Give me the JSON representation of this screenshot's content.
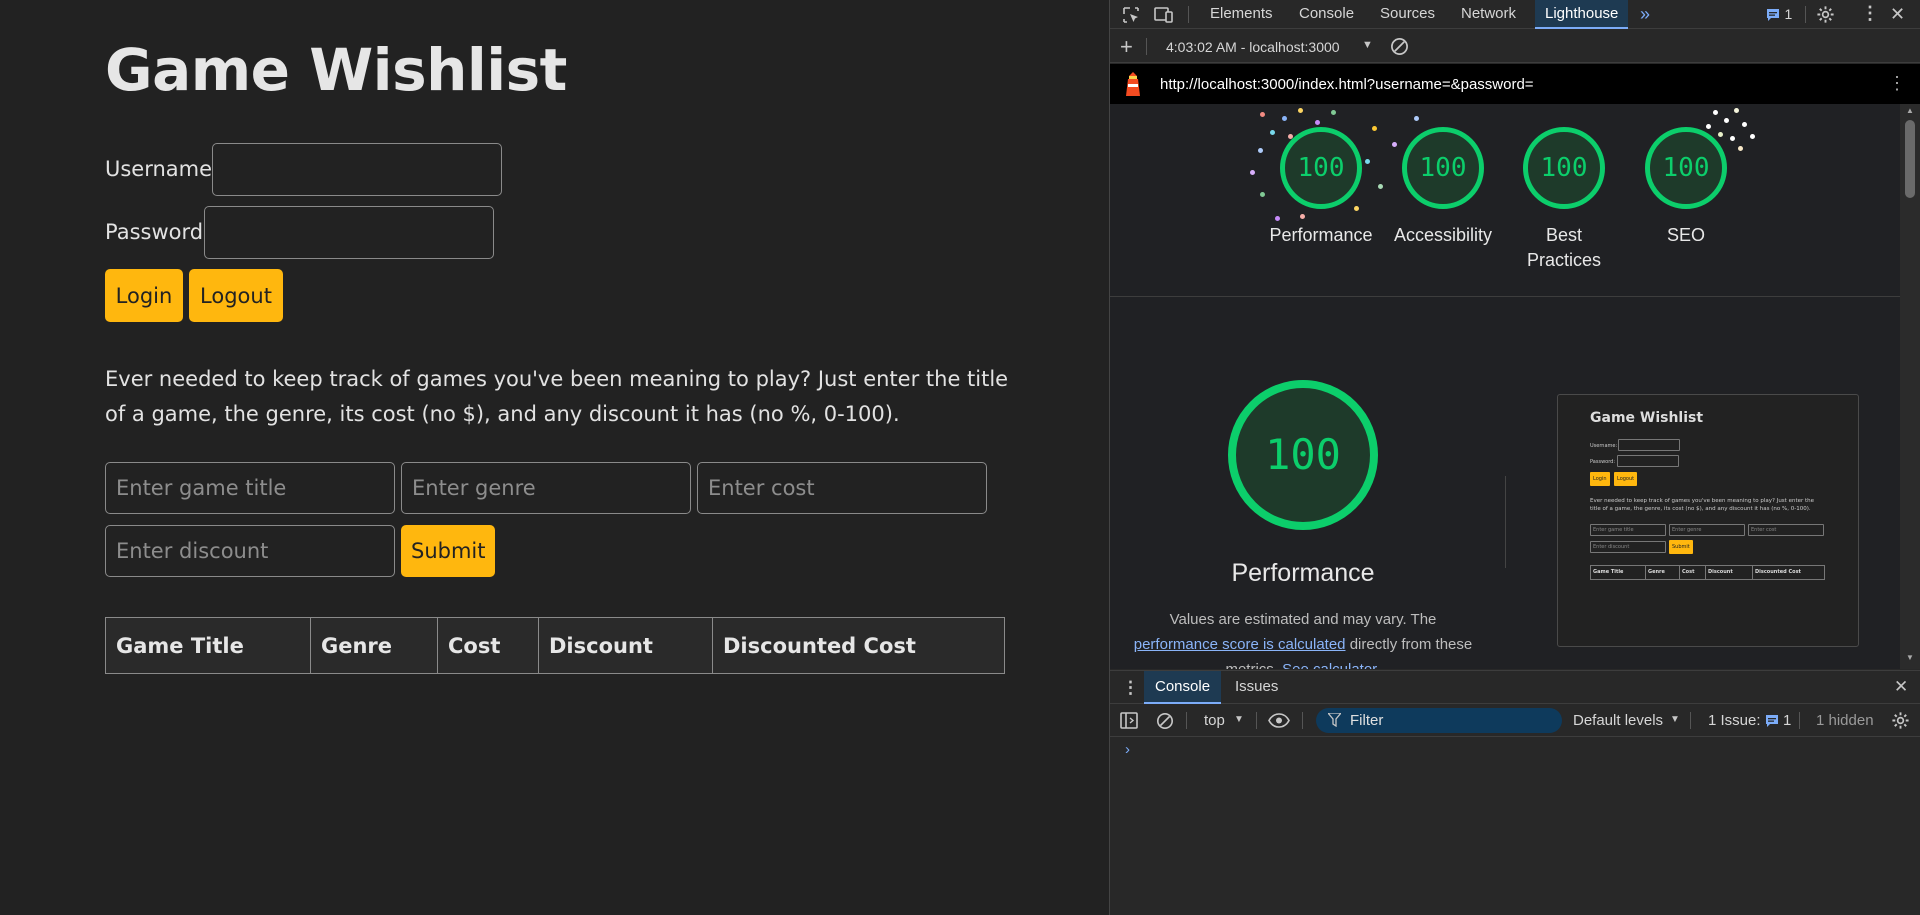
{
  "app": {
    "title": "Game Wishlist",
    "username_label": "Username:",
    "password_label": "Password:",
    "login_label": "Login",
    "logout_label": "Logout",
    "description": "Ever needed to keep track of games you've been meaning to play? Just enter the title of a game, the genre, its cost (no $), and any discount it has (no %, 0-100).",
    "game_title_placeholder": "Enter game title",
    "genre_placeholder": "Enter genre",
    "cost_placeholder": "Enter cost",
    "discount_placeholder": "Enter discount",
    "submit_label": "Submit",
    "table_headers": [
      "Game Title",
      "Genre",
      "Cost",
      "Discount",
      "Discounted Cost"
    ],
    "accent_color": "#ffb70e"
  },
  "devtools": {
    "tabs": [
      "Elements",
      "Console",
      "Sources",
      "Network",
      "Lighthouse"
    ],
    "active_tab": "Lighthouse",
    "issues_count": "1",
    "report_selector": "4:03:02 AM - localhost:3000",
    "report_url": "http://localhost:3000/index.html?username=&password=",
    "scores": [
      {
        "label": "Performance",
        "value": "100"
      },
      {
        "label": "Accessibility",
        "value": "100"
      },
      {
        "label": "Best Practices",
        "value": "100"
      },
      {
        "label": "SEO",
        "value": "100"
      }
    ],
    "score_color": "#0cce6b",
    "main_score": "100",
    "main_category": "Performance",
    "main_desc_1": "Values are estimated and may vary. The",
    "main_desc_link": "performance score is calculated",
    "main_desc_2": "directly from these",
    "main_desc_3": "metrics.",
    "main_desc_link2": "See calculator.",
    "thumbnail": {
      "title": "Game Wishlist",
      "username": "Username:",
      "password": "Password:",
      "login": "Login",
      "logout": "Logout",
      "desc": "Ever needed to keep track of games you've been meaning to play? Just enter the title of a game, the genre, its cost (no $), and any discount it has (no %, 0-100).",
      "ph_title": "Enter game title",
      "ph_genre": "Enter genre",
      "ph_cost": "Enter cost",
      "ph_discount": "Enter discount",
      "submit": "Submit",
      "headers": [
        "Game Title",
        "Genre",
        "Cost",
        "Discount",
        "Discounted Cost"
      ]
    },
    "drawer": {
      "tabs": [
        "Console",
        "Issues"
      ],
      "active_tab": "Console",
      "context": "top",
      "filter_placeholder": "Filter",
      "levels": "Default levels",
      "issues_label": "1 Issue:",
      "issues_count": "1",
      "hidden": "1 hidden",
      "prompt": "›"
    }
  }
}
